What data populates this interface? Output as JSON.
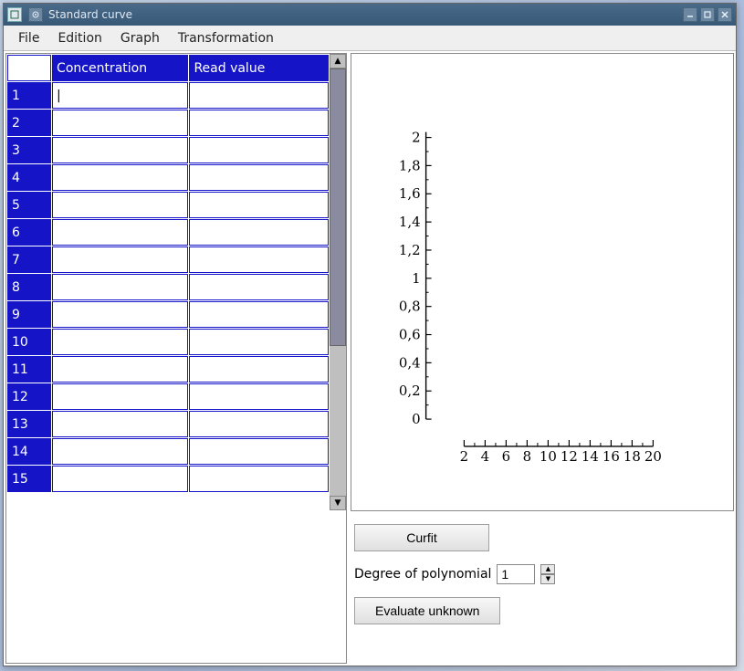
{
  "window": {
    "title": "Standard curve"
  },
  "menu": {
    "file": "File",
    "edition": "Edition",
    "graph": "Graph",
    "transformation": "Transformation"
  },
  "table": {
    "headers": {
      "concentration": "Concentration",
      "read_value": "Read value"
    },
    "rows": [
      {
        "n": "1",
        "c": "",
        "r": ""
      },
      {
        "n": "2",
        "c": "",
        "r": ""
      },
      {
        "n": "3",
        "c": "",
        "r": ""
      },
      {
        "n": "4",
        "c": "",
        "r": ""
      },
      {
        "n": "5",
        "c": "",
        "r": ""
      },
      {
        "n": "6",
        "c": "",
        "r": ""
      },
      {
        "n": "7",
        "c": "",
        "r": ""
      },
      {
        "n": "8",
        "c": "",
        "r": ""
      },
      {
        "n": "9",
        "c": "",
        "r": ""
      },
      {
        "n": "10",
        "c": "",
        "r": ""
      },
      {
        "n": "11",
        "c": "",
        "r": ""
      },
      {
        "n": "12",
        "c": "",
        "r": ""
      },
      {
        "n": "13",
        "c": "",
        "r": ""
      },
      {
        "n": "14",
        "c": "",
        "r": ""
      },
      {
        "n": "15",
        "c": "",
        "r": ""
      }
    ]
  },
  "controls": {
    "curfit": "Curfit",
    "degree_label": "Degree of polynomial",
    "degree_value": "1",
    "evaluate": "Evaluate unknown"
  },
  "chart_data": {
    "type": "scatter",
    "title": "",
    "xlabel": "",
    "ylabel": "",
    "xlim": [
      0,
      20
    ],
    "ylim": [
      0,
      2
    ],
    "xticks": [
      2,
      4,
      6,
      8,
      10,
      12,
      14,
      16,
      18,
      20
    ],
    "yticks": [
      "0",
      "0,2",
      "0,4",
      "0,6",
      "0,8",
      "1",
      "1,2",
      "1,4",
      "1,6",
      "1,8",
      "2"
    ],
    "series": []
  }
}
